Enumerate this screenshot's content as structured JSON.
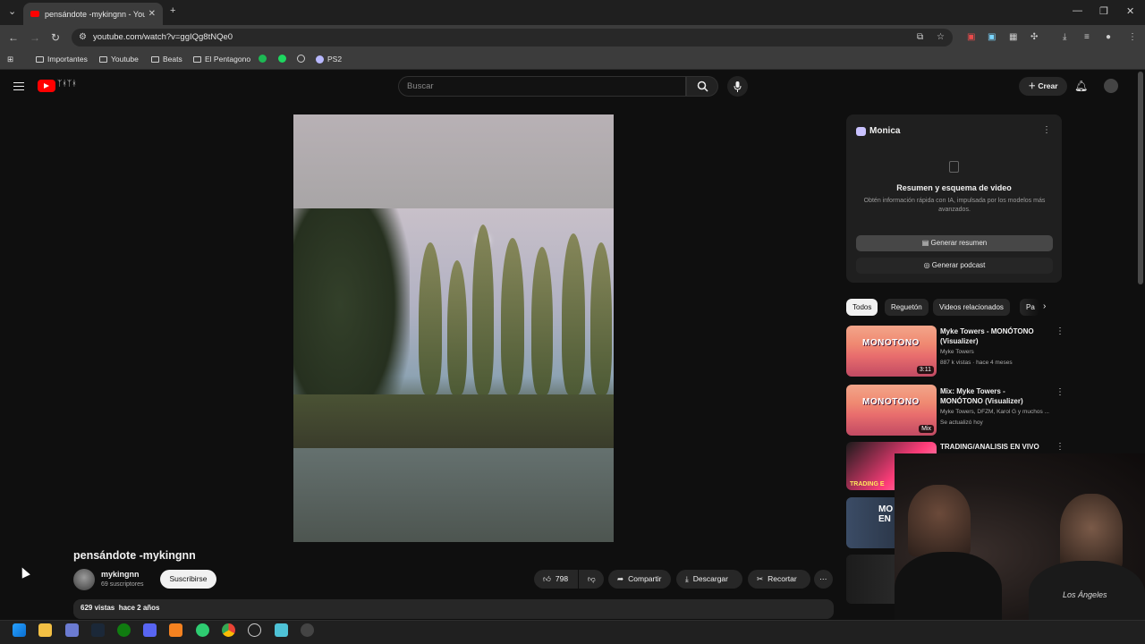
{
  "browser": {
    "tab_title": "pensándote -mykingnn - YouTu",
    "tab_close": "✕",
    "new_tab": "+",
    "url": "youtube.com/watch?v=ggIQg8tNQe0",
    "bookmarks": [
      {
        "label": "Importantes",
        "type": "folder"
      },
      {
        "label": "Youtube",
        "type": "folder"
      },
      {
        "label": "Beats",
        "type": "folder"
      },
      {
        "label": "El Pentagono",
        "type": "folder"
      },
      {
        "label": "PS2",
        "type": "site"
      }
    ]
  },
  "youtube": {
    "search_placeholder": "Buscar",
    "create_label": "Crear",
    "video": {
      "title": "pensándote -mykingnn",
      "channel": "mykingnn",
      "subscribers": "69 suscriptores",
      "subscribe_label": "Suscribirse",
      "likes": "798",
      "share_label": "Compartir",
      "download_label": "Descargar",
      "clip_label": "Recortar",
      "views_date": "629 vistas  hace 2 años"
    },
    "monica": {
      "name": "Monica",
      "heading": "Resumen y esquema de video",
      "description": "Obtén información rápida con IA, impulsada por los modelos más avanzados.",
      "summary_button": "Generar resumen",
      "podcast_button": "Generar podcast"
    },
    "chips": [
      "Todos",
      "Reguetón",
      "Videos relacionados",
      "Pa"
    ],
    "recommendations": [
      {
        "title": "Myke Towers - MONÓTONO (Visualizer)",
        "channel": "Myke Towers",
        "meta": "887 k vistas · hace 4 meses",
        "duration": "3:11",
        "thumb_text": "MONOTONO"
      },
      {
        "title": "Mix: Myke Towers - MONÓTONO (Visualizer)",
        "channel": "Myke Towers, DFZM, Karol G y muchos ...",
        "meta": "Se actualizó hoy",
        "duration": "Mix",
        "thumb_text": "MONOTONO"
      },
      {
        "title": "TRADING/ANALISIS EN VIVO",
        "thumb_text": "TRADING E"
      },
      {
        "thumb_text": "MO EN"
      }
    ]
  },
  "webcam": {
    "overlay_text": "Los Ángeles"
  },
  "colors": {
    "accent": "#ff0000",
    "background": "#0f0f0f",
    "chip_active": "#f1f1f1"
  }
}
